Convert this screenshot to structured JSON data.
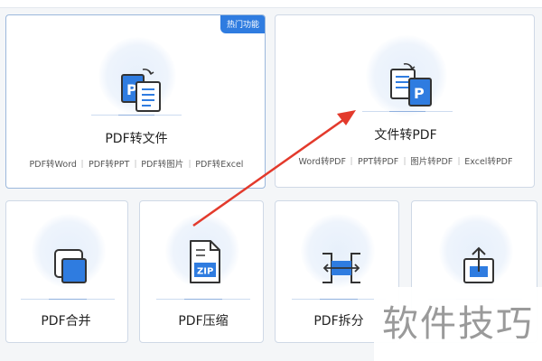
{
  "badge": {
    "hot": "热门功能"
  },
  "cards": {
    "pdf_to_file": {
      "title": "PDF转文件",
      "links": [
        "PDF转Word",
        "PDF转PPT",
        "PDF转图片",
        "PDF转Excel"
      ]
    },
    "file_to_pdf": {
      "title": "文件转PDF",
      "links": [
        "Word转PDF",
        "PPT转PDF",
        "图片转PDF",
        "Excel转PDF"
      ]
    },
    "merge": {
      "title": "PDF合并"
    },
    "compress": {
      "title": "PDF压缩",
      "icon_text": "ZIP"
    },
    "split": {
      "title": "PDF拆分"
    },
    "export": {
      "title": ""
    }
  },
  "watermark": {
    "text": "软件技巧"
  },
  "colors": {
    "accent": "#2f7ce0",
    "arrow": "#e33a2c",
    "border": "#cfd9e6"
  }
}
